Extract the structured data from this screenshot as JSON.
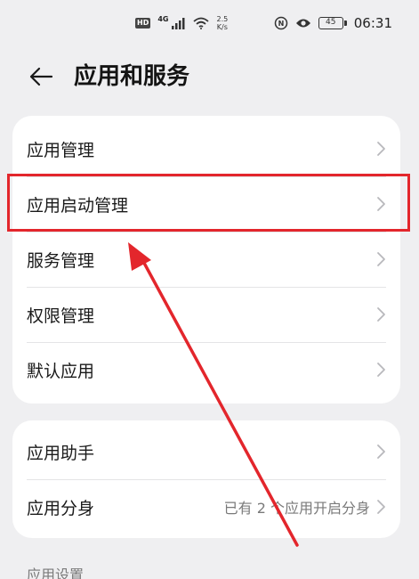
{
  "status_bar": {
    "hd": "HD",
    "network": "4G",
    "speed_value": "2.5",
    "speed_unit": "K/s",
    "battery": "45",
    "time": "06:31"
  },
  "header": {
    "title": "应用和服务"
  },
  "group1": {
    "items": [
      {
        "label": "应用管理"
      },
      {
        "label": "应用启动管理"
      },
      {
        "label": "服务管理"
      },
      {
        "label": "权限管理"
      },
      {
        "label": "默认应用"
      }
    ]
  },
  "group2": {
    "items": [
      {
        "label": "应用助手",
        "value": ""
      },
      {
        "label": "应用分身",
        "value": "已有 2 个应用开启分身"
      }
    ]
  },
  "section_label": "应用设置",
  "colors": {
    "background": "#efeff1",
    "card": "#ffffff",
    "annotation_red": "#e3262c",
    "text_primary": "#1a1a1a",
    "text_secondary": "#7a7a7a"
  }
}
